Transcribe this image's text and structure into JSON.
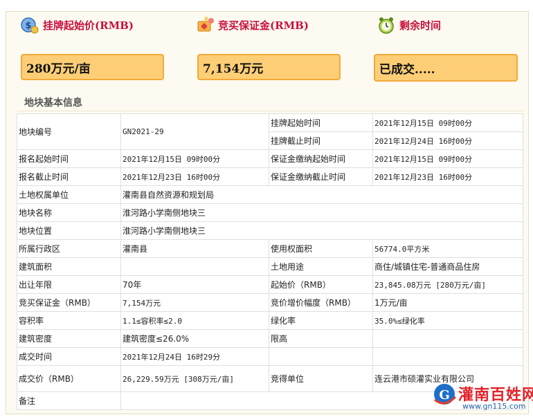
{
  "stats": [
    {
      "label": "挂牌起始价(RMB)",
      "value": "280万元/亩",
      "icon": "money-bag-icon"
    },
    {
      "label": "竞买保证金(RMB)",
      "value": "7,154万元",
      "icon": "deposit-icon"
    },
    {
      "label": "剩余时间",
      "value": "已成交.....",
      "icon": "alarm-clock-icon"
    }
  ],
  "section_title": "地块基本信息",
  "info": {
    "r1": {
      "l1": "地块编号",
      "v1": "GN2021-29",
      "l2": "挂牌起始时间",
      "v2": "2021年12月15日 09时00分"
    },
    "r1b": {
      "l2": "挂牌截止时间",
      "v2": "2021年12月24日 16时00分"
    },
    "r2": {
      "l1": "报名起始时间",
      "v1": "2021年12月15日 09时00分",
      "l2": "保证金缴纳起始时间",
      "v2": "2021年12月15日 09时00分"
    },
    "r3": {
      "l1": "报名截止时间",
      "v1": "2021年12月23日 16时00分",
      "l2": "保证金缴纳截止时间",
      "v2": "2021年12月23日 16时00分"
    },
    "r4": {
      "l1": "土地权属单位",
      "v1": "灌南县自然资源和规划局"
    },
    "r5": {
      "l1": "地块名称",
      "v1": "淮河路小学南侧地块三"
    },
    "r6": {
      "l1": "地块位置",
      "v1": "淮河路小学南侧地块三"
    },
    "r7": {
      "l1": "所属行政区",
      "v1": "灌南县",
      "l2": "使用权面积",
      "v2": "56774.0平方米"
    },
    "r8": {
      "l1": "建筑面积",
      "v1": "",
      "l2": "土地用途",
      "v2": "商住/城镇住宅-普通商品住房"
    },
    "r9": {
      "l1": "出让年限",
      "v1": "70年",
      "l2": "起始价（RMB）",
      "v2": "23,845.08万元 [280万元/亩]"
    },
    "r10": {
      "l1": "竞买保证金（RMB）",
      "v1": "7,154万元",
      "l2": "竞价增价幅度（RMB）",
      "v2": "1万元/亩"
    },
    "r11": {
      "l1": "容积率",
      "v1": "1.1≤容积率≤2.0",
      "l2": "绿化率",
      "v2": "35.0%≤绿化率"
    },
    "r12": {
      "l1": "建筑密度",
      "v1": "建筑密度≤26.0%",
      "l2": "限高",
      "v2": ""
    },
    "r13": {
      "l1": "成交时间",
      "v1": "2021年12月24日 16时29分"
    },
    "r14": {
      "l1": "成交价（RMB）",
      "v1": "26,229.59万元 [308万元/亩]",
      "l2": "竞得单位",
      "v2": "连云港市硕灌实业有限公司"
    },
    "r15": {
      "l1": "备注",
      "v1": ""
    }
  },
  "watermark": {
    "brand": "灌南百姓网",
    "url": "www.gn115.com"
  },
  "colors": {
    "accent_red": "#c8103c",
    "box_fill": "#fdce76",
    "box_border": "#f2a93a",
    "panel_bg": "#fdfbf1"
  }
}
